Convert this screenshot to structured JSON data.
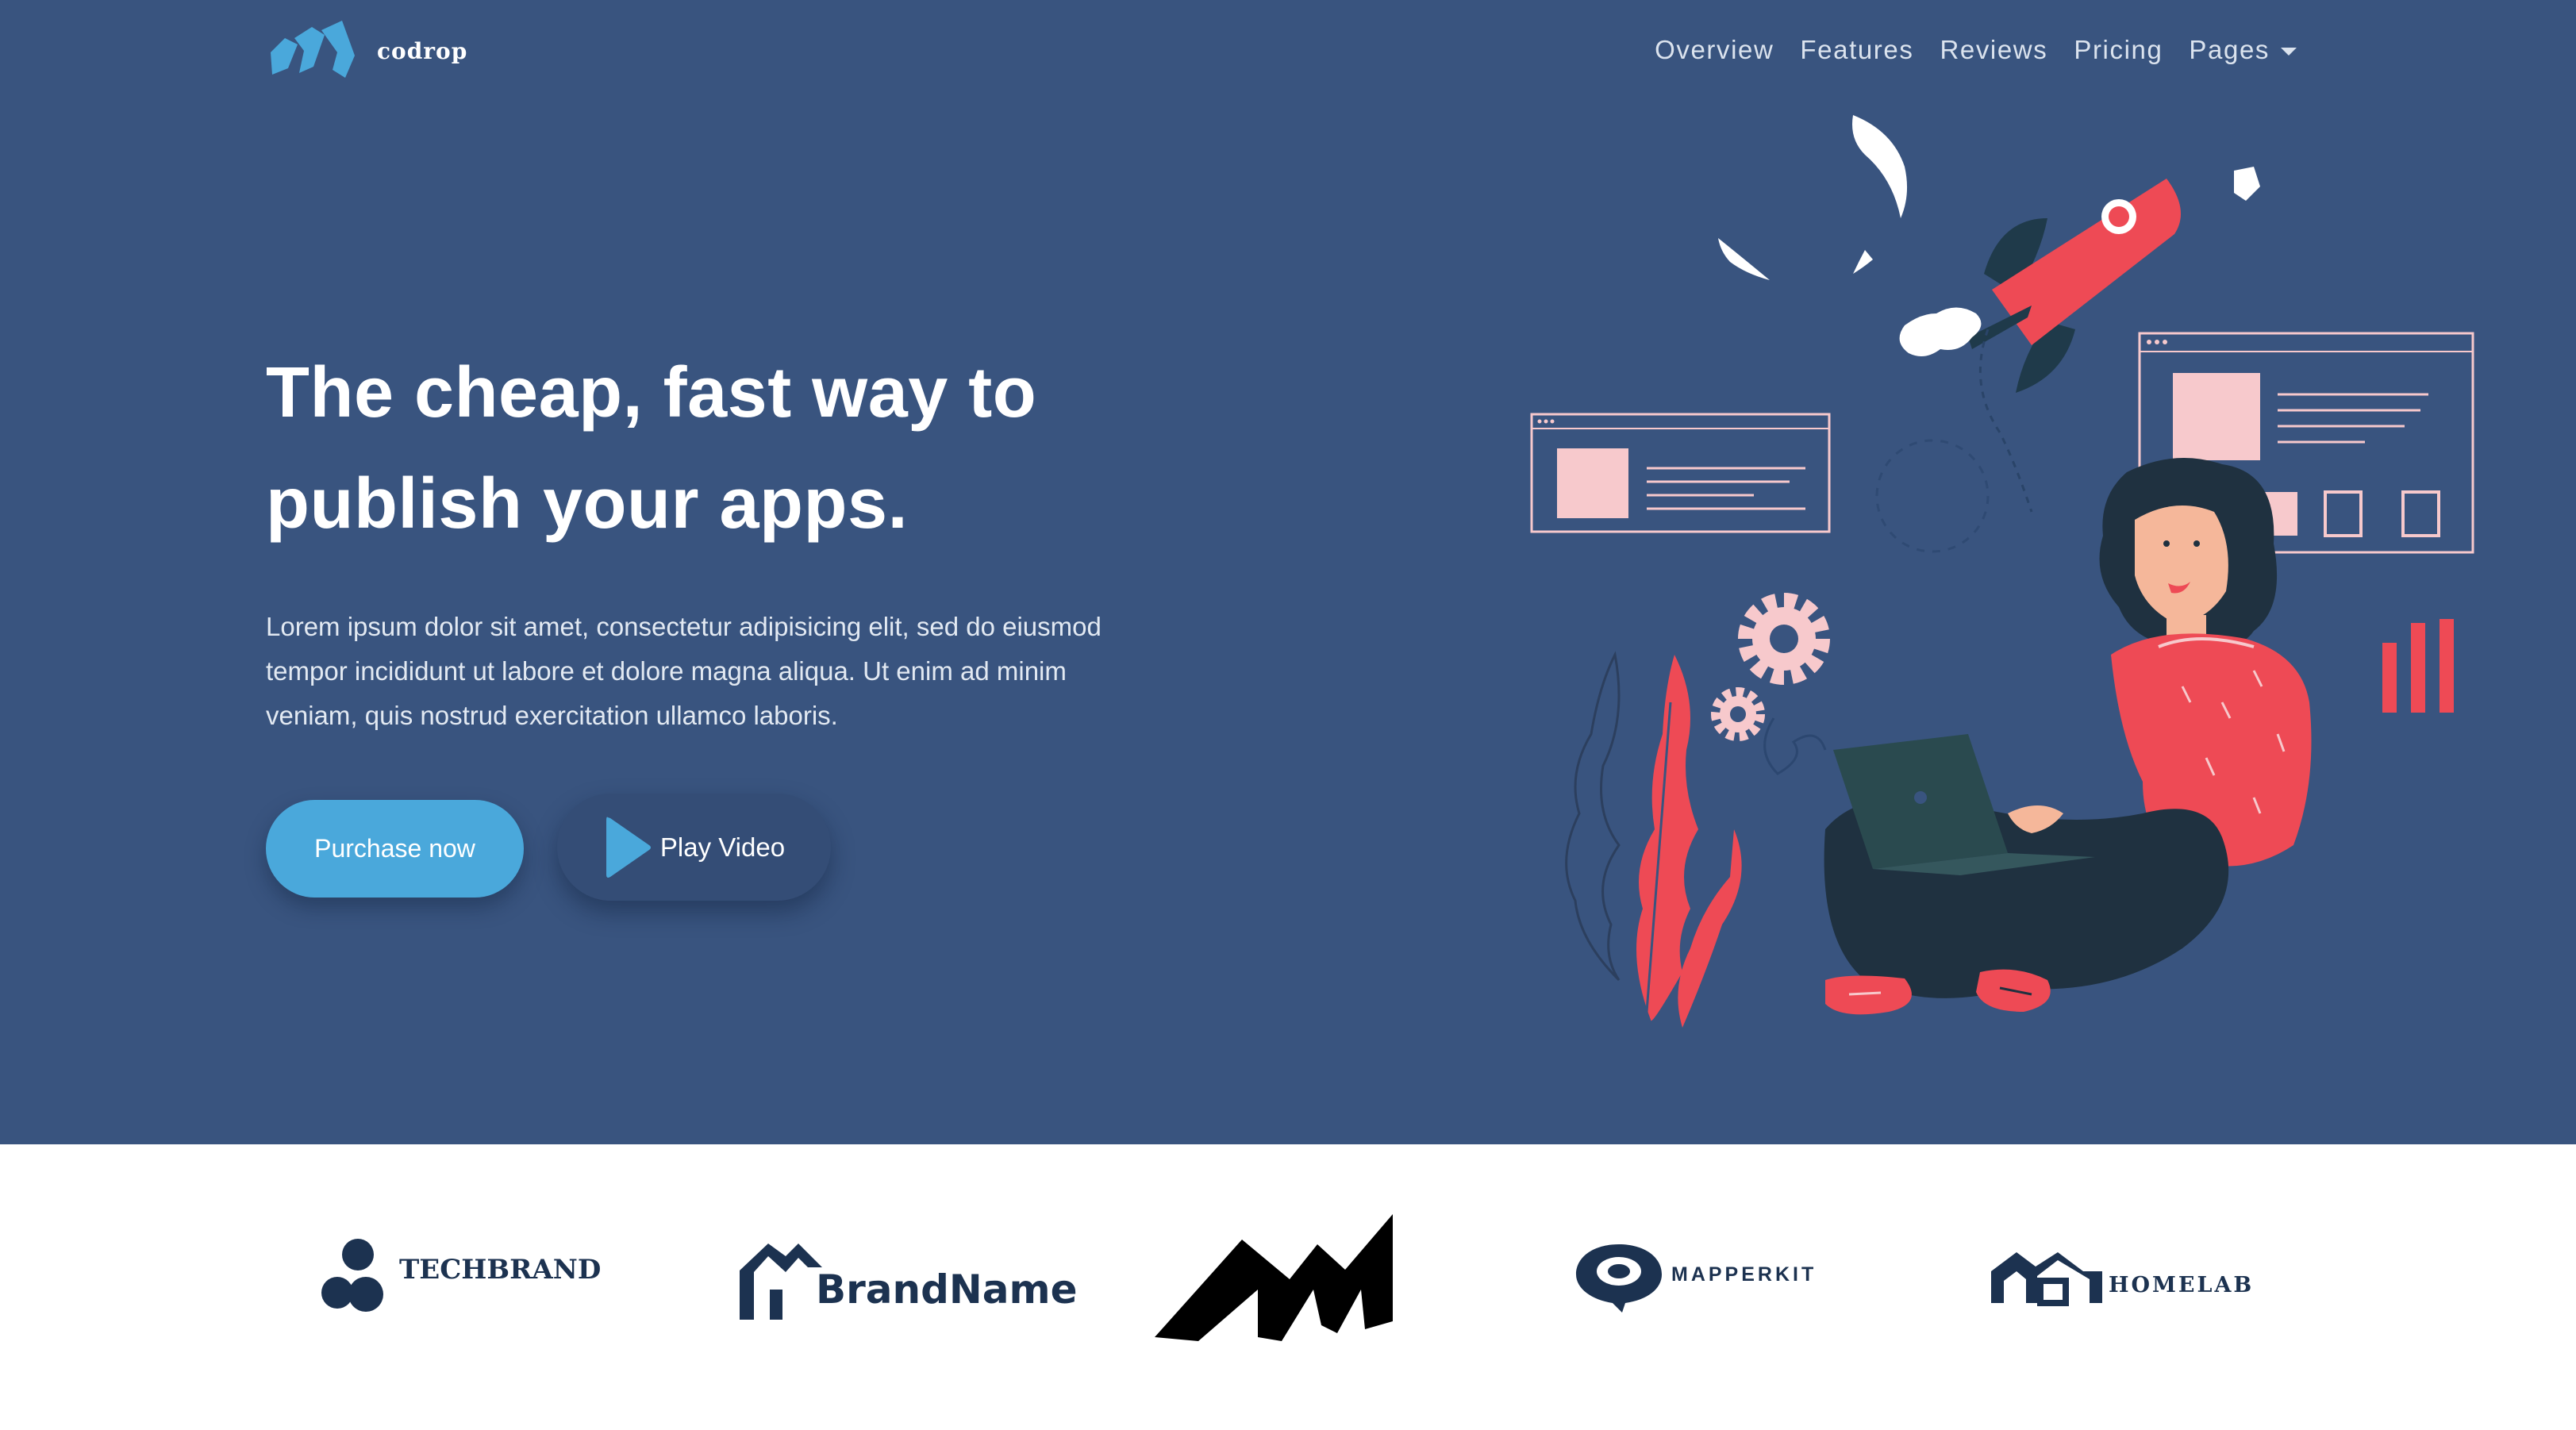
{
  "header": {
    "logo_text": "codrop",
    "nav": [
      {
        "label": "Overview"
      },
      {
        "label": "Features"
      },
      {
        "label": "Reviews"
      },
      {
        "label": "Pricing"
      },
      {
        "label": "Pages"
      }
    ]
  },
  "hero": {
    "headline": "The cheap, fast way to publish your apps.",
    "paragraph": "Lorem ipsum dolor sit amet, consectetur adipisicing elit, sed do eiusmod tempor incididunt ut labore et dolore magna aliqua. Ut enim ad minim veniam, quis nostrud exercitation ullamco laboris.",
    "purchase_label": "Purchase now",
    "play_label": "Play Video"
  },
  "brands": [
    {
      "name": "TECHBRAND"
    },
    {
      "name": "BrandName"
    },
    {
      "name": ""
    },
    {
      "name": "MAPPERKIT"
    },
    {
      "name": "HOMELAB"
    }
  ],
  "colors": {
    "hero_bg": "#39547f",
    "accent": "#4aa8db",
    "illustration_red": "#ee4a55",
    "illustration_pink": "#f7c9cc",
    "brand_navy": "#1c3250"
  },
  "icons": {
    "logo": "codrop-logo-icon",
    "play": "play-icon",
    "caret": "caret-down-icon"
  }
}
